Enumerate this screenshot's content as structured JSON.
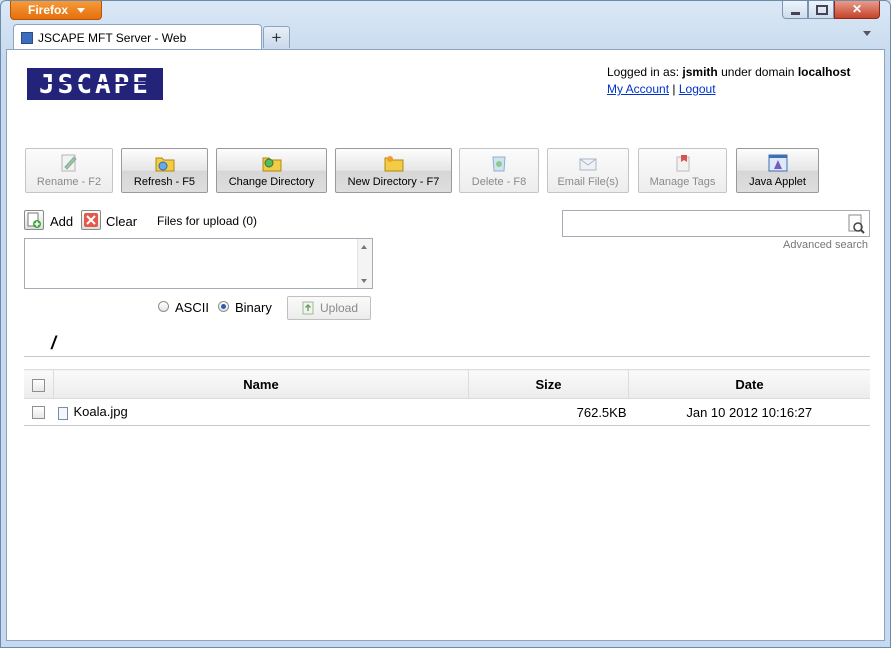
{
  "browser": {
    "menu_label": "Firefox",
    "tab_title": "JSCAPE MFT Server - Web",
    "new_tab_label": "+",
    "close_symbol": "✕"
  },
  "header": {
    "logo_text": "JSCAPE",
    "logged_in_prefix": "Logged in as:",
    "username": "jsmith",
    "under_domain": "under domain",
    "domain": "localhost",
    "my_account": "My Account",
    "separator": "|",
    "logout": "Logout"
  },
  "toolbar": {
    "buttons": [
      {
        "label": "Rename - F2",
        "icon": "rename-icon",
        "enabled": false
      },
      {
        "label": "Refresh - F5",
        "icon": "refresh-folder-icon",
        "enabled": true
      },
      {
        "label": "Change Directory",
        "icon": "change-directory-icon",
        "enabled": true
      },
      {
        "label": "New Directory - F7",
        "icon": "new-folder-icon",
        "enabled": true
      },
      {
        "label": "Delete - F8",
        "icon": "recycle-bin-icon",
        "enabled": false
      },
      {
        "label": "Email File(s)",
        "icon": "email-icon",
        "enabled": false
      },
      {
        "label": "Manage Tags",
        "icon": "tag-icon",
        "enabled": false
      },
      {
        "label": "Java Applet",
        "icon": "java-applet-icon",
        "enabled": true
      }
    ]
  },
  "upload": {
    "add_label": "Add",
    "clear_label": "Clear",
    "files_for_upload": "Files for upload (0)",
    "mode_ascii": "ASCII",
    "mode_binary": "Binary",
    "selected_mode": "Binary",
    "upload_label": "Upload"
  },
  "search": {
    "value": "",
    "advanced_label": "Advanced search"
  },
  "current_path": "/",
  "file_table": {
    "columns": {
      "name": "Name",
      "size": "Size",
      "date": "Date"
    },
    "rows": [
      {
        "name": "Koala.jpg",
        "size": "762.5KB",
        "date": "Jan 10 2012 10:16:27"
      }
    ]
  }
}
